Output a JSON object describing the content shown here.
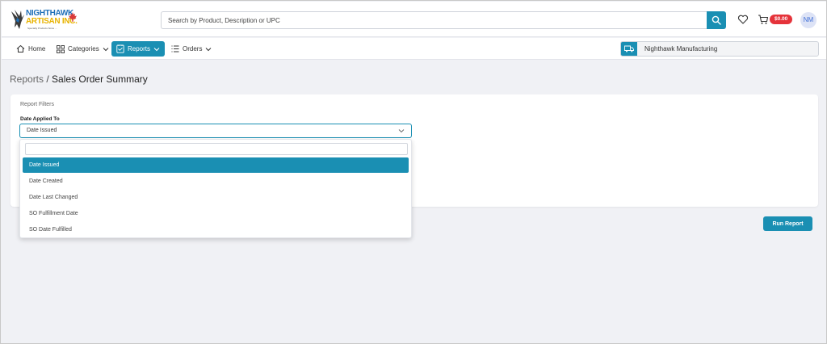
{
  "brand": {
    "line1": "NIGHTHAWK",
    "line2": "ARTISAN INC.",
    "tagline": "Specialty Products Since ..."
  },
  "search": {
    "placeholder": "Search by Product, Description or UPC"
  },
  "header": {
    "cart_total": "$0.00",
    "avatar_initials": "NM"
  },
  "nav": {
    "home": "Home",
    "categories": "Categories",
    "reports": "Reports",
    "orders": "Orders",
    "company": "Nighthawk Manufacturing"
  },
  "breadcrumb": {
    "root": "Reports",
    "separator": " / ",
    "current": "Sales Order Summary"
  },
  "filters": {
    "title": "Report Filters",
    "date_label": "Date Applied To",
    "date_value": "Date Issued",
    "options": [
      "Date Issued",
      "Date Created",
      "Date Last Changed",
      "SO Fulfillment Date",
      "SO Date Fulfilled"
    ],
    "selected_index": 0
  },
  "actions": {
    "run_report": "Run Report"
  },
  "colors": {
    "accent": "#1a8fb3",
    "badge": "#e5333a",
    "background": "#f0f1f5"
  }
}
